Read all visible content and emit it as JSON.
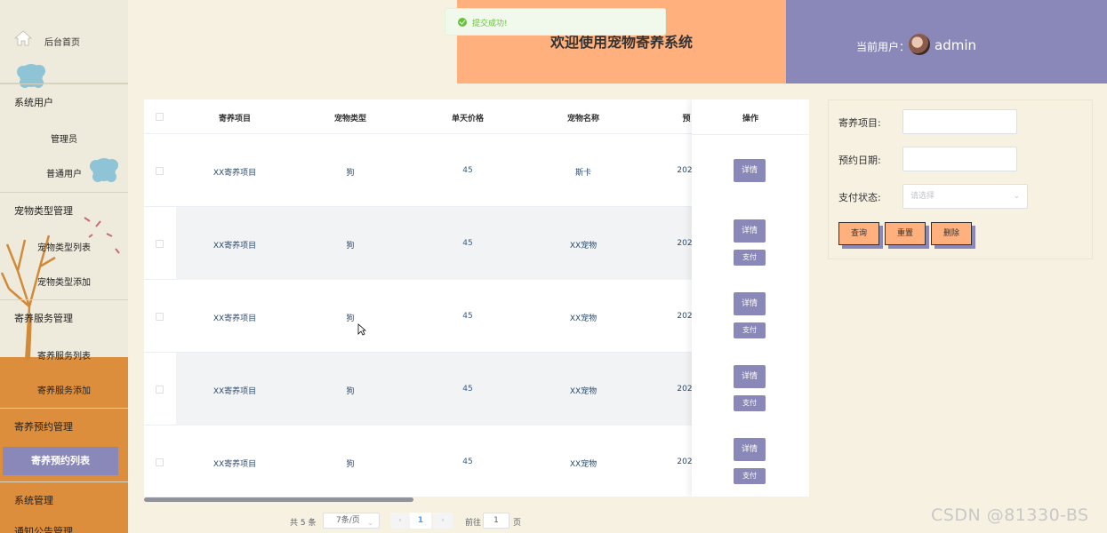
{
  "sidebar": {
    "home": "后台首页",
    "groups": [
      {
        "label": "系统用户",
        "items": [
          "管理员",
          "普通用户"
        ]
      },
      {
        "label": "宠物类型管理",
        "items": [
          "宠物类型列表",
          "宠物类型添加"
        ]
      },
      {
        "label": "寄养服务管理",
        "items": [
          "寄养服务列表",
          "寄养服务添加"
        ]
      },
      {
        "label": "寄养预约管理",
        "items": [
          "寄养预约列表"
        ]
      },
      {
        "label": "系统管理",
        "items": []
      },
      {
        "label": "通知公告管理",
        "items": []
      }
    ],
    "active_item": "寄养预约列表"
  },
  "header": {
    "title": "欢迎使用宠物寄养系统",
    "user_label": "当前用户：",
    "username": "admin"
  },
  "toast": {
    "message": "提交成功!",
    "type": "success"
  },
  "table": {
    "columns": [
      "寄养项目",
      "宠物类型",
      "单天价格",
      "宠物名称",
      "预",
      "操作"
    ],
    "rows": [
      {
        "project": "XX寄养项目",
        "pet_type": "狗",
        "price": "45",
        "pet_name": "斯卡",
        "date": "202",
        "actions": [
          "详情"
        ]
      },
      {
        "project": "XX寄养项目",
        "pet_type": "狗",
        "price": "45",
        "pet_name": "XX宠物",
        "date": "202",
        "actions": [
          "详情",
          "支付"
        ]
      },
      {
        "project": "XX寄养项目",
        "pet_type": "狗",
        "price": "45",
        "pet_name": "XX宠物",
        "date": "202",
        "actions": [
          "详情",
          "支付"
        ]
      },
      {
        "project": "XX寄养项目",
        "pet_type": "狗",
        "price": "45",
        "pet_name": "XX宠物",
        "date": "202",
        "actions": [
          "详情",
          "支付"
        ]
      },
      {
        "project": "XX寄养项目",
        "pet_type": "狗",
        "price": "45",
        "pet_name": "XX宠物",
        "date": "202",
        "actions": [
          "详情",
          "支付"
        ]
      }
    ]
  },
  "pagination": {
    "total": "共 5 条",
    "page_size": "7条/页",
    "prev": "‹",
    "current": "1",
    "next": "›",
    "goto_label": "前往",
    "goto_value": "1",
    "page_suffix": "页"
  },
  "search": {
    "project_label": "寄养项目:",
    "date_label": "预约日期:",
    "pay_label": "支付状态:",
    "pay_placeholder": "请选择",
    "query_btn": "查询",
    "reset_btn": "重置",
    "delete_btn": "删除"
  },
  "watermark": "CSDN @81330-BS",
  "colors": {
    "accent_purple": "#8a88b8",
    "accent_orange": "#ffb07c",
    "sidebar_orange": "#dc8e3c",
    "background": "#f7f1e2"
  }
}
